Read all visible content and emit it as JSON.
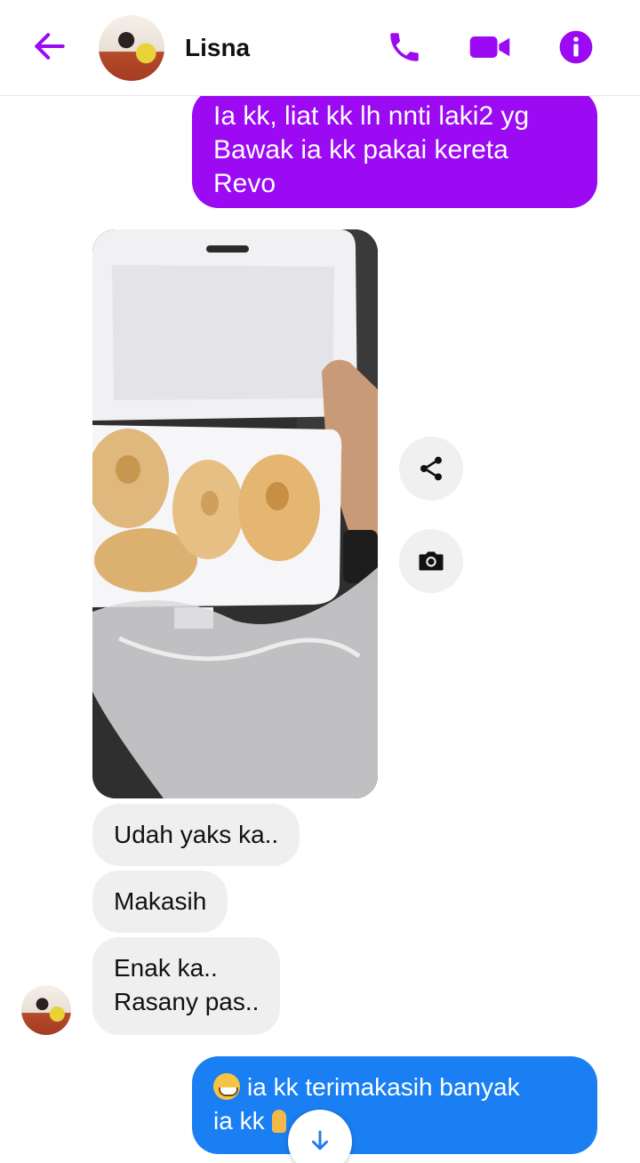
{
  "header": {
    "contact_name": "Lisna",
    "back_icon": "arrow-left-icon",
    "call_icon": "phone-icon",
    "video_icon": "video-camera-icon",
    "info_icon": "info-icon",
    "accent_color": "#9b0af2"
  },
  "messages": {
    "outgoing_1": {
      "lines": [
        "Ia kk, liat kk lh nnti laki2 yg",
        "Bawak ia kk pakai kereta",
        "Revo"
      ],
      "color": "#9b0af2"
    },
    "photo": {
      "description_icon": "photo-donuts-image"
    },
    "photo_actions": {
      "share_icon": "share-icon",
      "camera_icon": "camera-icon"
    },
    "incoming_1": "Udah yaks ka..",
    "incoming_2": "Makasih",
    "incoming_3": {
      "lines": [
        "Enak ka..",
        "Rasany pas.."
      ]
    },
    "outgoing_2": {
      "lines": [
        "ia kk terimakasih banyak",
        "ia kk"
      ],
      "color": "#1a7ff2"
    }
  },
  "scroll_button": {
    "icon": "arrow-down-icon"
  }
}
